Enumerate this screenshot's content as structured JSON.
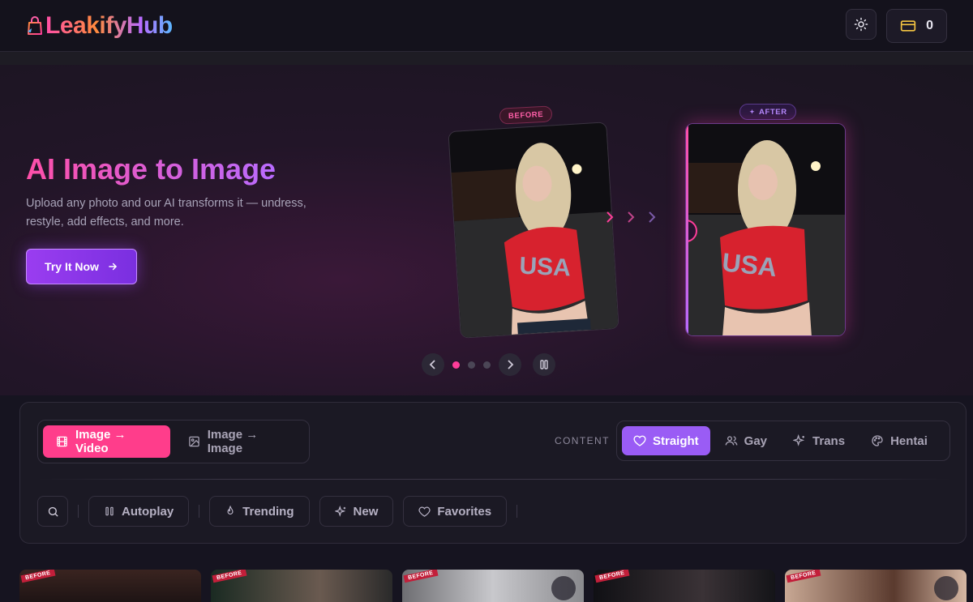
{
  "header": {
    "brand": "LeakifyHub",
    "credits": "0",
    "icons": {
      "logo": "shopping-bag-icon",
      "theme": "sun-icon",
      "credits": "credit-card-icon"
    }
  },
  "hero": {
    "title": "AI Image to Image",
    "subtitle": "Upload any photo and our AI transforms it — undress, restyle, add effects, and more.",
    "cta_label": "Try It Now",
    "before_label": "BEFORE",
    "after_label": "AFTER",
    "carousel": {
      "slides": 3,
      "active_index": 0
    },
    "accent": "#ff3d9a"
  },
  "modes": [
    {
      "label": "Image → Video",
      "active": true,
      "icon": "film-icon"
    },
    {
      "label": "Image → Image",
      "active": false,
      "icon": "image-icon"
    }
  ],
  "content": {
    "label": "CONTENT",
    "categories": [
      {
        "label": "Straight",
        "active": true,
        "icon": "heart-icon"
      },
      {
        "label": "Gay",
        "active": false,
        "icon": "users-icon"
      },
      {
        "label": "Trans",
        "active": false,
        "icon": "sparkles-icon"
      },
      {
        "label": "Hentai",
        "active": false,
        "icon": "palette-icon"
      }
    ]
  },
  "filters": [
    {
      "label": "Autoplay",
      "icon": "pause-icon"
    },
    {
      "label": "Trending",
      "icon": "flame-icon"
    },
    {
      "label": "New",
      "icon": "sparkles-icon"
    },
    {
      "label": "Favorites",
      "icon": "heart-icon"
    }
  ],
  "gallery": {
    "tag": "BEFORE",
    "items": 5
  }
}
